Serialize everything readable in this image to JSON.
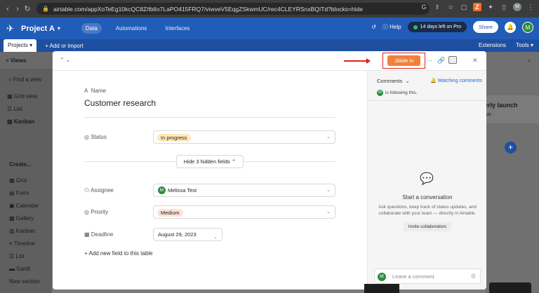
{
  "browser": {
    "url": "airtable.com/appXoTeEg10kcQC8Z/tblIo7LaPO415FRQ7/viwveV5EqgZSkwmUC/rec4CLEYRSnxBQITd?blocks=hide",
    "profile_initial": "M"
  },
  "header": {
    "project_name": "Project A",
    "tabs": [
      "Data",
      "Automations",
      "Interfaces"
    ],
    "help_label": "Help",
    "trial_label": "14 days left on Pro",
    "share_label": "Share",
    "user_initial": "M"
  },
  "subheader": {
    "projects_tab": "Projects",
    "add_import": "Add or import",
    "extensions": "Extensions",
    "tools": "Tools"
  },
  "background": {
    "views_label": "Views",
    "find_view": "Find a view",
    "views": [
      "Grid view",
      "List",
      "Kanban"
    ],
    "create_label": "Create...",
    "create_items": [
      "Grid",
      "Form",
      "Calendar",
      "Gallery",
      "Kanban",
      "Timeline",
      "List",
      "Gantt",
      "New section"
    ],
    "card_title": "erly launch",
    "card_sub": "rus"
  },
  "record": {
    "name_label": "Name",
    "title": "Customer research",
    "status_label": "Status",
    "status_value": "In progress",
    "hidden_fields_label": "Hide 3 hidden fields",
    "assignee_label": "Assignee",
    "assignee_value": "Melissa Test",
    "assignee_initial": "M",
    "priority_label": "Priority",
    "priority_value": "Medium",
    "deadline_label": "Deadline",
    "deadline_value": "August 29, 2023",
    "add_field_label": "Add new field to this table"
  },
  "toolbar": {
    "jibble_label": "Jibble in"
  },
  "comments": {
    "title": "Comments",
    "watching": "Watching comments",
    "following_text": "is following this.",
    "start_title": "Start a conversation",
    "start_desc": "Ask questions, keep track of status updates, and collaborate with your team — directly in Airtable.",
    "invite_label": "Invite collaborators",
    "leave_placeholder": "Leave a comment"
  },
  "colors": {
    "header_blue": "#215cb8",
    "jibble_orange": "#f0803c",
    "highlight_red": "#e02020",
    "status_yellow": "#ffeab6",
    "priority_peach": "#fee2d5"
  }
}
